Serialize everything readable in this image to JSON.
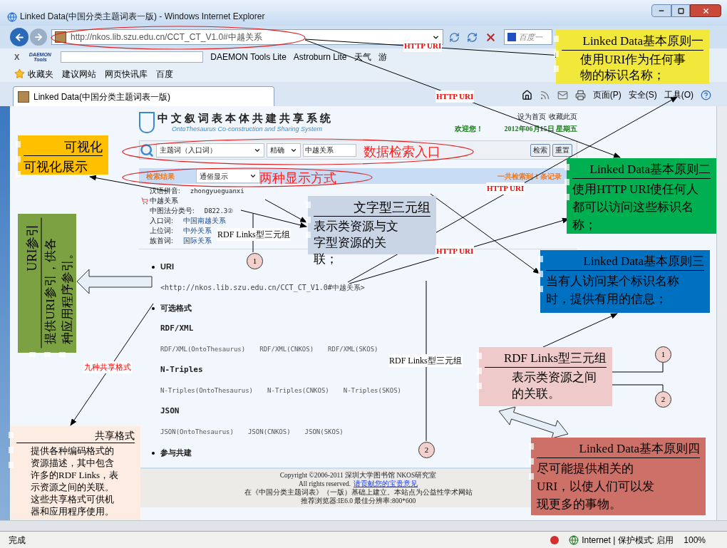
{
  "window": {
    "title": "Linked Data(中国分类主题词表一版) - Windows Internet Explorer"
  },
  "address_bar": {
    "url": "http://nkos.lib.szu.edu.cn/CCT_CT_V1.0#中越关系",
    "search_value": "百度一"
  },
  "toolbar": {
    "close": "X",
    "logo": "DAEMON Tools",
    "items": [
      "DAEMON Tools Lite",
      "Astroburn Lite",
      "天气",
      "游"
    ]
  },
  "favorites": {
    "label": "收藏夹",
    "items": [
      "建议网站",
      "网页快讯库",
      "百度"
    ]
  },
  "tabs": [
    {
      "label": "Linked Data(中国分类主题词表一版)",
      "selected": true
    }
  ],
  "command_bar": [
    "页面(P)",
    "安全(S)",
    "工具(O)"
  ],
  "site": {
    "header": {
      "title": "中文叙词表本体共建共享系统",
      "subtitle": "OntoThesaurus Co-construction and Sharing System",
      "links": [
        "设为首页",
        "收藏此页"
      ],
      "welcome": "欢迎您！",
      "date": "2012年06月15日 星期五"
    },
    "search": {
      "field_type": "主题词（入口词）",
      "match": "精确",
      "query": "中越关系",
      "buttons": [
        "检索",
        "重置"
      ]
    },
    "results": {
      "label": "检索结果",
      "display": "通俗显示",
      "count": "一共检索到 1 条记录"
    },
    "term": [
      {
        "kind": "text",
        "label": "汉语拼音:",
        "value": "zhongyueguanxi"
      },
      {
        "kind": "heading",
        "label": "中越关系"
      },
      {
        "kind": "text",
        "label": "中图法分类号:",
        "value": "D822.3②"
      },
      {
        "kind": "link",
        "label": "入口词:",
        "value": "中国南越关系"
      },
      {
        "kind": "link",
        "label": "上位词:",
        "value": "中外关系"
      },
      {
        "kind": "link",
        "label": "族首词:",
        "value": "国际关系"
      }
    ],
    "sections": [
      {
        "kind": "uri",
        "title": "URI",
        "uri": "<http://nkos.lib.szu.edu.cn/CCT_CT_V1.0#中越关系>"
      },
      {
        "kind": "formats",
        "title": "可选格式",
        "formats": [
          {
            "name": "RDF/XML",
            "links": [
              "RDF/XML(OntoThesaurus)",
              "RDF/XML(CNKOS)",
              "RDF/XML(SKOS)"
            ]
          },
          {
            "name": "N-Triples",
            "links": [
              "N-Triples(OntoThesaurus)",
              "N-Triples(CNKOS)",
              "N-Triples(SKOS)"
            ]
          },
          {
            "name": "JSON",
            "links": [
              "JSON(OntoThesaurus)",
              "JSON(CNKOS)",
              "JSON(SKOS)"
            ]
          }
        ]
      },
      {
        "kind": "plain",
        "title": "参与共建"
      }
    ],
    "footer": {
      "copyright": "Copyright ©2006-2011 深圳大学图书馆  NKOS研究室",
      "rights": "All rights reserved.",
      "feedback_link": "请贡献您的宝贵意见",
      "basis": "在《中国分类主题词表》（一版）基础上建立。本站点为公益性学术网站",
      "browser": "推荐浏览器:IE6.0 最佳分辨率:800*600"
    }
  },
  "annotations": {
    "callouts": [
      {
        "kind": "box",
        "title": "可视化",
        "body": "可视化展示",
        "color": "#ffc000"
      },
      {
        "kind": "vertical",
        "title": "URI参引",
        "body": "提供URI参引，供各种应用程序参引。",
        "color": "#7ca142"
      },
      {
        "kind": "box",
        "title": "共享格式",
        "body": "提供各种编码格式的资源描述，其中包含许多的RDF Links，表示资源之间的关联。这些共享格式可供机器和应用程序使用。",
        "color": "#fcece2"
      },
      {
        "kind": "box",
        "title": "文字型三元组",
        "body": "表示类资源与文字型资源的关联；",
        "color": "#c9d5e5"
      },
      {
        "kind": "box",
        "title": "Linked Data基本原则一",
        "body": "使用URI作为任何事物的标识名称；",
        "color": "#f2e83c"
      },
      {
        "kind": "box",
        "title": "Linked Data基本原则二",
        "body": "使用HTTP URI使任何人都可以访问这些标识名称；",
        "color": "#00b050"
      },
      {
        "kind": "box",
        "title": "Linked Data基本原则三",
        "body": "当有人访问某个标识名称时，提供有用的信息；",
        "color": "#0070c0"
      },
      {
        "kind": "box",
        "title": "RDF Links型三元组",
        "body": "表示类资源之间的关联。",
        "color": "#eecbca"
      },
      {
        "kind": "box",
        "title": "Linked Data基本原则四",
        "body": "尽可能提供相关的URI，以使人们可以发现更多的事物。",
        "color": "#cd7068"
      }
    ],
    "labels": [
      {
        "kind": "tag",
        "text": "HTTP URI"
      },
      {
        "kind": "tag",
        "text": "HTTP URI"
      },
      {
        "kind": "tag",
        "text": "HTTP URI"
      },
      {
        "kind": "tag",
        "text": "HTTP URI"
      },
      {
        "kind": "note",
        "text": "RDF Links型三元组"
      },
      {
        "kind": "note",
        "text": "RDF Links型三元组"
      },
      {
        "kind": "red_note",
        "text": "九种共享格式"
      },
      {
        "kind": "heading",
        "text": "数据检索入口"
      },
      {
        "kind": "heading",
        "text": "两种显示方式"
      }
    ],
    "markers": [
      "1",
      "2",
      "1",
      "2"
    ]
  },
  "status_bar": {
    "text": "完成",
    "zone": "Internet | 保护模式: 启用",
    "zoom": "100%"
  }
}
